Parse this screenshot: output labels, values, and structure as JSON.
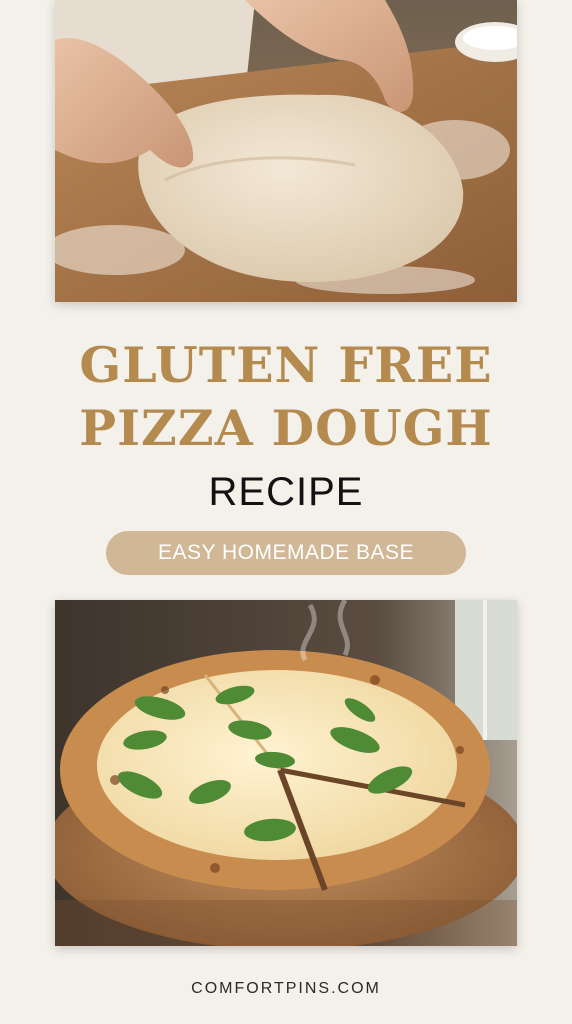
{
  "title": {
    "line_1": "GLUTEN FREE",
    "line_2": "PIZZA DOUGH"
  },
  "subtitle": "RECIPE",
  "tagline": "EASY HOMEMADE BASE",
  "footer": "COMFORTPINS.COM",
  "colors": {
    "background": "#f4f0ea",
    "title": "#b48a4f",
    "tagline_pill": "#d0b796",
    "tagline_text": "#ffffff",
    "subtitle": "#121212"
  },
  "images": {
    "top": "photo of hands stretching pizza dough on a floured wooden board",
    "bottom": "photo of a sliced white pizza with melted mozzarella and basil on a wooden board"
  }
}
